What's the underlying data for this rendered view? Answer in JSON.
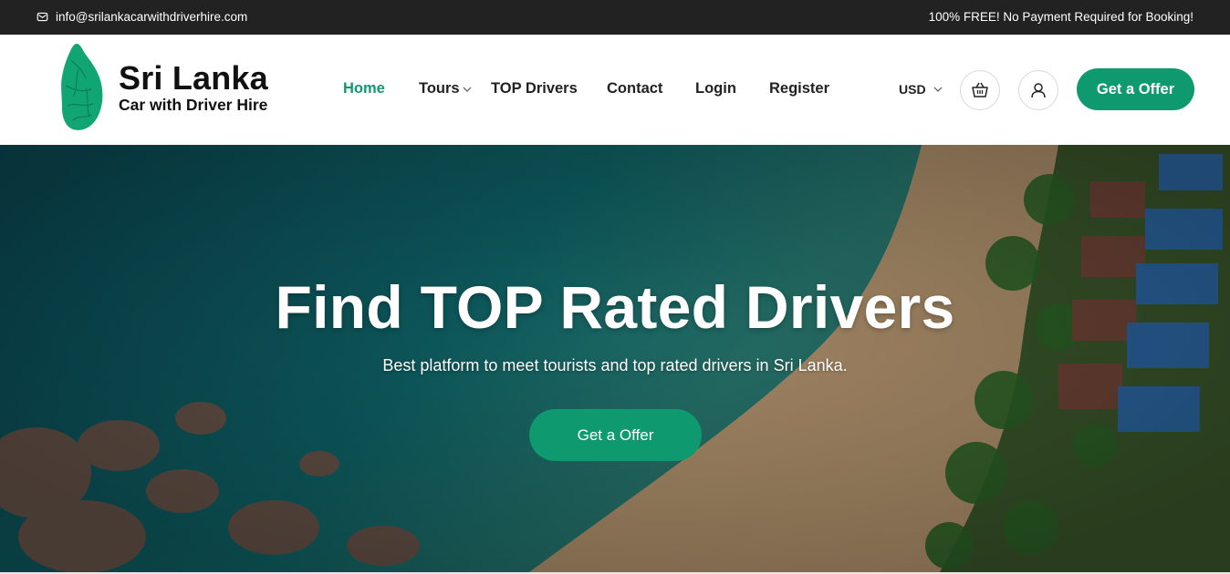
{
  "topbar": {
    "email": "info@srilankacarwithdriverhire.com",
    "notice": "100% FREE! No Payment Required for Booking!"
  },
  "logo": {
    "title": "Sri Lanka",
    "subtitle": "Car with Driver Hire"
  },
  "nav": {
    "items": [
      {
        "label": "Home",
        "active": true
      },
      {
        "label": "Tours",
        "dropdown": true
      },
      {
        "label": "TOP Drivers"
      },
      {
        "label": "Contact"
      },
      {
        "label": "Login"
      },
      {
        "label": "Register"
      }
    ]
  },
  "header": {
    "currency": "USD",
    "offer_button": "Get a Offer"
  },
  "hero": {
    "title": "Find TOP Rated Drivers",
    "subtitle": "Best platform to meet tourists and top rated drivers in Sri Lanka.",
    "button": "Get a Offer"
  },
  "colors": {
    "accent": "#0e9a6e",
    "topbar": "#222222"
  },
  "icons": [
    "mail-icon",
    "chevron-down-icon",
    "basket-icon",
    "user-icon"
  ]
}
